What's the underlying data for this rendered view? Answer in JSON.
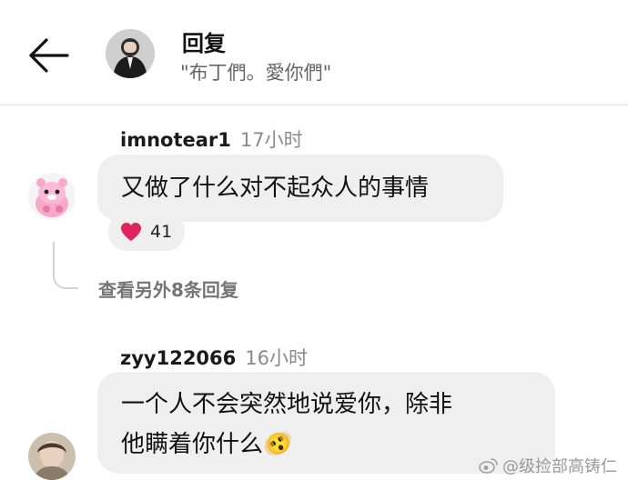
{
  "header": {
    "title": "回复",
    "subtitle": "\"布丁們。愛你們\"",
    "back_icon": "arrow-left-icon"
  },
  "comments": [
    {
      "username": "imnotear1",
      "time": "17小时",
      "text": "又做了什么对不起众人的事情",
      "reaction_icon": "heart-icon",
      "reaction_color": "#e0245e",
      "likes": "41"
    },
    {
      "username": "zyy122066",
      "time": "16小时",
      "text_line1": "一个人不会突然地说爱你，除非",
      "text_line2": "他瞒着你什么🫨"
    }
  ],
  "more_replies": "查看另外8条回复",
  "watermark": "@级捡部高铸仁",
  "colors": {
    "bubble": "#efefef",
    "divider": "#e4e4e4",
    "muted_text": "#8a8a8a"
  }
}
